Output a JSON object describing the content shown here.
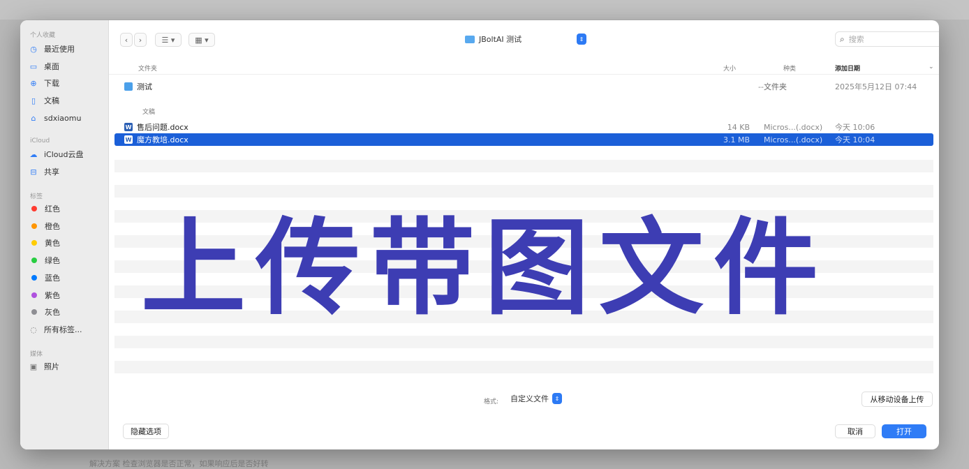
{
  "backdrop": {
    "bottom_text": "解决方案  检查浏览器是否正常，如果响应后是否好转"
  },
  "sidebar": {
    "sections": [
      {
        "label": "个人收藏"
      },
      {
        "label": "iCloud"
      },
      {
        "label": "标签"
      },
      {
        "label": "媒体"
      }
    ],
    "favorites": [
      {
        "label": "最近使用",
        "icon": "clock-icon",
        "glyph": "◷"
      },
      {
        "label": "桌面",
        "icon": "desktop-icon",
        "glyph": "▭"
      },
      {
        "label": "下载",
        "icon": "download-icon",
        "glyph": "⊕"
      },
      {
        "label": "文稿",
        "icon": "document-icon",
        "glyph": "▯"
      },
      {
        "label": "sdxiaomu",
        "icon": "home-icon",
        "glyph": "⌂"
      }
    ],
    "icloud": [
      {
        "label": "iCloud云盘",
        "icon": "cloud-icon",
        "glyph": "☁"
      },
      {
        "label": "共享",
        "icon": "shared-folder-icon",
        "glyph": "⊟"
      }
    ],
    "tags": [
      {
        "label": "红色",
        "color": "#ff3b30"
      },
      {
        "label": "橙色",
        "color": "#ff9500"
      },
      {
        "label": "黄色",
        "color": "#ffcc00"
      },
      {
        "label": "绿色",
        "color": "#28cd41"
      },
      {
        "label": "蓝色",
        "color": "#007aff"
      },
      {
        "label": "紫色",
        "color": "#af52de"
      },
      {
        "label": "灰色",
        "color": "#8e8e93"
      }
    ],
    "all_tags": {
      "label": "所有标签...",
      "icon": "tag-icon",
      "glyph": "◌"
    },
    "media": [
      {
        "label": "照片",
        "icon": "photos-icon",
        "glyph": "▣"
      }
    ]
  },
  "toolbar": {
    "back_glyph": "‹",
    "forward_glyph": "›",
    "view_list_glyph": "☰ ▾",
    "view_grid_glyph": "▦ ▾",
    "location": "JBoltAI 测试",
    "location_stepper": "⇕",
    "search_placeholder": "搜索",
    "search_glyph": "⌕"
  },
  "columns": {
    "name": "文件夹",
    "size": "大小",
    "kind": "种类",
    "date": "添加日期",
    "sort_glyph": "⌄"
  },
  "folders": [
    {
      "name": "测试",
      "size": "--",
      "kind": "文件夹",
      "date": "2025年5月12日 07:44"
    }
  ],
  "group_label": "文稿",
  "files": [
    {
      "name": "售后问题.docx",
      "size": "14 KB",
      "kind": "Micros...(.docx)",
      "date": "今天 10:06",
      "selected": false
    },
    {
      "name": "魔方教培.docx",
      "size": "3.1 MB",
      "kind": "Micros...(.docx)",
      "date": "今天 10:04",
      "selected": true
    }
  ],
  "bottom": {
    "format_label": "格式:",
    "format_value": "自定义文件",
    "format_stepper": "⇕",
    "mobile_upload": "从移动设备上传",
    "hide_options": "隐藏选项",
    "cancel": "取消",
    "open": "打开"
  },
  "overlay": {
    "caption": "上传带图文件",
    "color": "#3d3db3"
  },
  "accent_color": "#2f7cf6",
  "selection_color": "#1b5fd8"
}
